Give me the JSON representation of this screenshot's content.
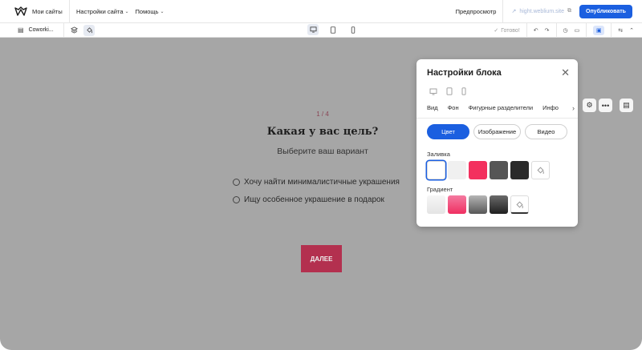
{
  "topbar": {
    "brand": "Мои сайты",
    "menu": [
      {
        "label": "Настройки сайта",
        "has_dropdown": true
      },
      {
        "label": "Помощь",
        "has_dropdown": true
      }
    ],
    "preview": "Предпросмотр",
    "domain": "hight.weblium.site",
    "publish": "Опубликовать"
  },
  "toolbar": {
    "page_name": "Coworki...",
    "status": "Готово!",
    "icons": [
      "layers-icon",
      "paint-bucket-icon",
      "desktop-icon",
      "tablet-icon",
      "mobile-icon",
      "undo-icon",
      "redo-icon",
      "history-icon",
      "comments-icon",
      "widget-icon",
      "settings-sliders-icon",
      "chevron-up-icon"
    ]
  },
  "quiz": {
    "counter": "1 / 4",
    "title": "Какая у вас цель?",
    "subtitle": "Выберите ваш вариант",
    "options": [
      "Хочу найти минималистичные украшения",
      "Ищу особенное украшение в подарок"
    ],
    "next_button": "ДАЛЕЕ"
  },
  "panel": {
    "title": "Настройки блока",
    "tabs": [
      "Вид",
      "Фон",
      "Фигурные разделители",
      "Инфо"
    ],
    "active_tab": "Фон",
    "background_types": [
      "Цвет",
      "Изображение",
      "Видео"
    ],
    "active_background_type": "Цвет",
    "fill_label": "Заливка",
    "gradient_label": "Градиент",
    "fill_swatches": [
      "#ffffff",
      "#f0f0f0",
      "#f3305e",
      "#555555",
      "#2a2a2a",
      "none"
    ],
    "selected_fill": 0,
    "gradient_swatches": [
      [
        "#f6f6f6",
        "#e4e4e4"
      ],
      [
        "#f47aa0",
        "#ef2f61"
      ],
      [
        "#b5b5b5",
        "#575757"
      ],
      [
        "#6a6a6a",
        "#1f1f1f"
      ],
      [
        "none"
      ]
    ]
  },
  "colors": {
    "accent": "#1b5fe0",
    "canvas_overlay": "#a6a6a6",
    "next_button": "#b3304f"
  }
}
